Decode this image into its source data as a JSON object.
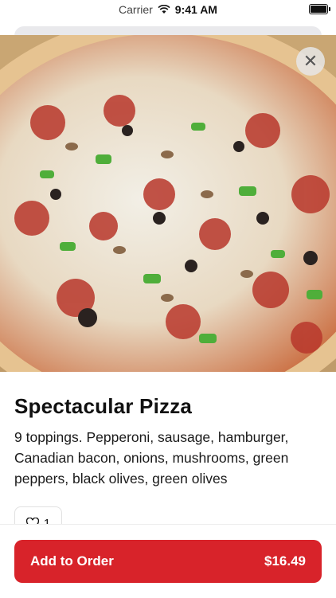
{
  "status_bar": {
    "carrier": "Carrier",
    "time": "9:41 AM"
  },
  "item": {
    "title": "Spectacular Pizza",
    "description": "9 toppings. Pepperoni, sausage, hamburger, Canadian bacon, onions, mushrooms, green peppers, black olives, green olives",
    "like_count": "1",
    "image_icon": "pizza-photo"
  },
  "actions": {
    "add_label": "Add to Order",
    "price": "$16.49"
  },
  "colors": {
    "accent": "#d8232a"
  }
}
